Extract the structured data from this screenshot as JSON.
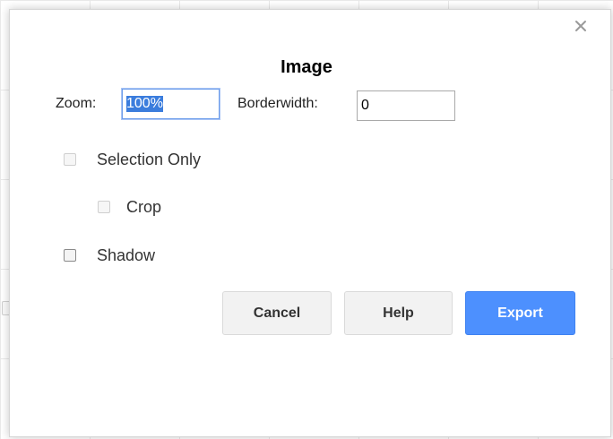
{
  "dialog": {
    "title": "Image",
    "zoom": {
      "label": "Zoom:",
      "value": "100%"
    },
    "borderwidth": {
      "label": "Borderwidth:",
      "value": "0"
    },
    "options": {
      "selection_only": {
        "label": "Selection Only",
        "checked": false,
        "disabled": true
      },
      "crop": {
        "label": "Crop",
        "checked": false,
        "disabled": true
      },
      "shadow": {
        "label": "Shadow",
        "checked": false,
        "disabled": false
      }
    },
    "buttons": {
      "cancel": "Cancel",
      "help": "Help",
      "export": "Export"
    },
    "close_icon": "close-icon"
  },
  "colors": {
    "primary_button": "#4d90fe",
    "secondary_button": "#f2f2f2",
    "input_focus": "#6d9eeb"
  }
}
